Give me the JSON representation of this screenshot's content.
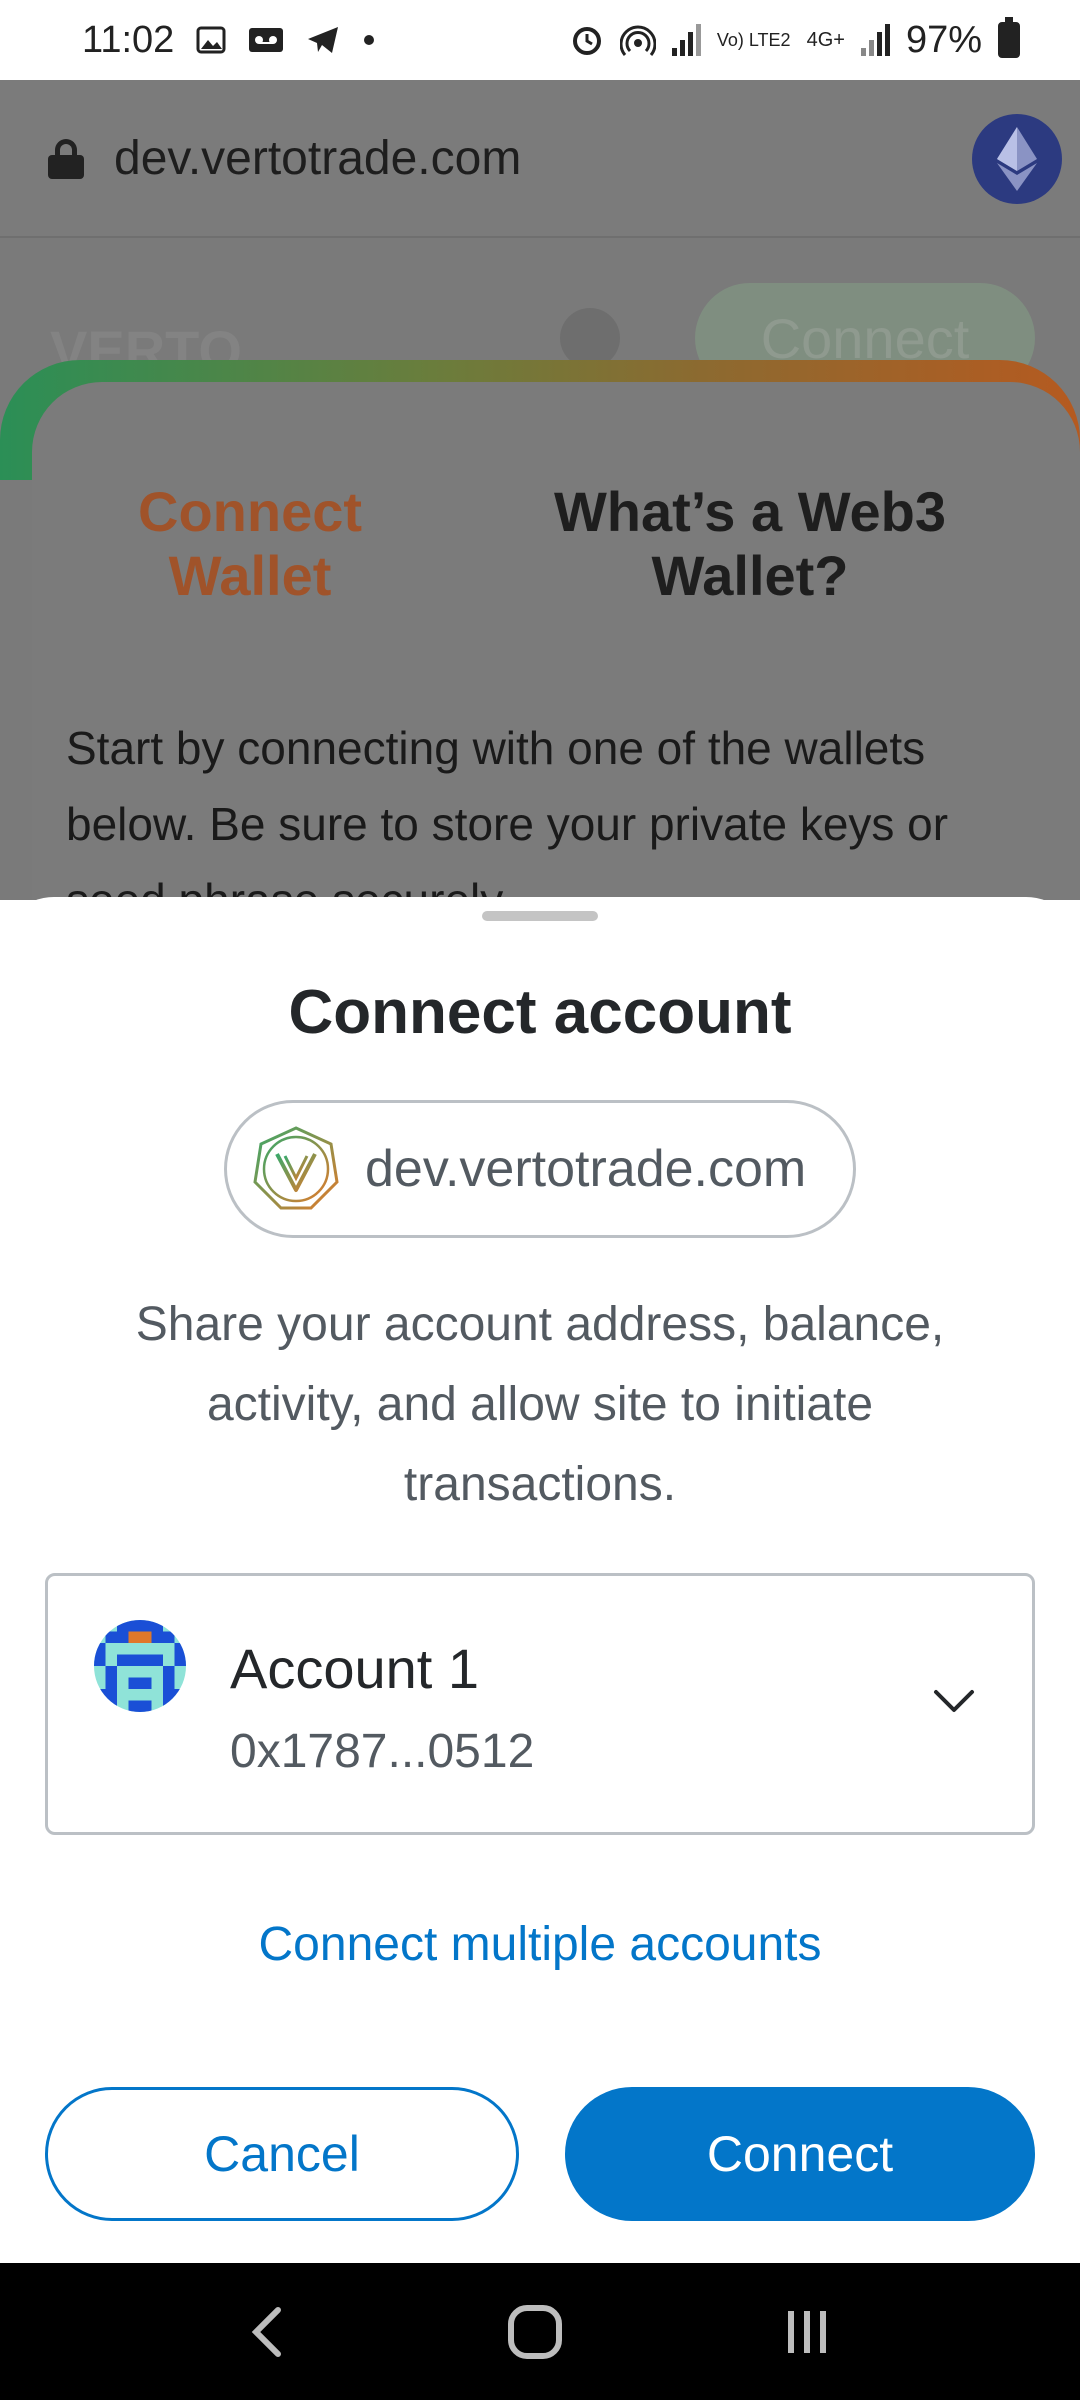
{
  "status_bar": {
    "time": "11:02",
    "battery": "97%",
    "network_label": "4G+",
    "volte_label": "Vo) LTE2",
    "icons": [
      "image-icon",
      "voicemail-icon",
      "telegram-icon",
      "dot-icon",
      "alarm-icon",
      "hotspot-icon",
      "signal-icon",
      "battery-icon"
    ]
  },
  "browser": {
    "url": "dev.vertotrade.com",
    "network_badge_icon": "ethereum-icon"
  },
  "background_page": {
    "logo_text": "VERTO",
    "connect_button_label": "Connect",
    "tab_connect_label_line1": "Connect",
    "tab_connect_label_line2": "Wallet",
    "tab_what_label_line1": "What’s a Web3",
    "tab_what_label_line2": "Wallet?",
    "paragraph": "Start by connecting with one of the wallets below. Be sure to store your private keys or seed phrase securely.",
    "colors": {
      "accent_orange": "#a0532a",
      "gradient_green": "#2b8f56",
      "gradient_orange": "#b55a20"
    }
  },
  "sheet": {
    "title": "Connect account",
    "site_url": "dev.vertotrade.com",
    "description": "Share your account address, balance, activity, and allow site to initiate transactions.",
    "account": {
      "name": "Account 1",
      "address": "0x1787...0512"
    },
    "multi_link": "Connect multiple accounts",
    "cancel_label": "Cancel",
    "connect_label": "Connect",
    "colors": {
      "primary": "#0376c9",
      "text": "#24272a",
      "muted": "#535a61"
    }
  },
  "nav_bar": {
    "icons": [
      "back-icon",
      "home-icon",
      "recents-icon"
    ]
  }
}
